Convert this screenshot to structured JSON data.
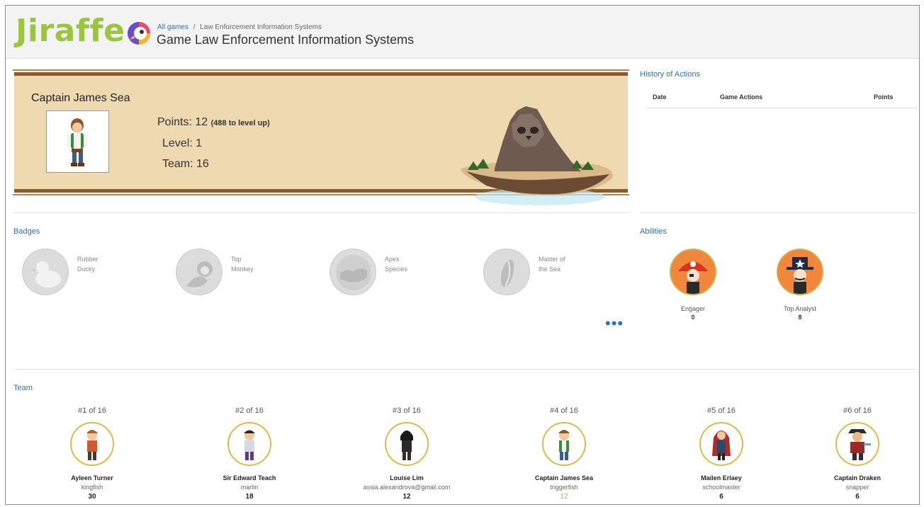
{
  "header": {
    "logo": "Jiraffe",
    "breadcrumb_root": "All games",
    "breadcrumb_sep": "/",
    "breadcrumb_current": "Law Enforcement Information Systems",
    "title": "Game Law Enforcement Information Systems"
  },
  "player": {
    "name": "Captain James Sea",
    "points_label": "Points:",
    "points_value": "12",
    "points_note": "(488 to level up)",
    "level_label": "Level:",
    "level_value": "1",
    "team_label": "Team:",
    "team_value": "16"
  },
  "history": {
    "label": "History of Actions",
    "columns": [
      "Date",
      "Game Actions",
      "Points"
    ]
  },
  "badges": {
    "label": "Badges",
    "items": [
      {
        "name": "Rubber\nDucky",
        "icon": "duck-icon"
      },
      {
        "name": "Top\nMonkey",
        "icon": "monkey-icon"
      },
      {
        "name": "Apex\nSpecies",
        "icon": "globe-icon"
      },
      {
        "name": "Master of\nthe Sea",
        "icon": "wave-icon"
      }
    ],
    "more": "•••"
  },
  "abilities": {
    "label": "Abilities",
    "items": [
      {
        "name": "Engager",
        "value": "0",
        "icon": "pirate-icon"
      },
      {
        "name": "Top Analyst",
        "value": "8",
        "icon": "sheriff-icon"
      }
    ]
  },
  "team": {
    "label": "Team",
    "members": [
      {
        "rank": "#1 of 16",
        "name": "Ayleen Turner",
        "sub": "kingfish",
        "points": "30"
      },
      {
        "rank": "#2 of 16",
        "name": "Sir Edward Teach",
        "sub": "marlin",
        "points": "18"
      },
      {
        "rank": "#3 of 16",
        "name": "Louise Lim",
        "sub": "assia.alexandrova@gmail.com",
        "points": "12"
      },
      {
        "rank": "#4 of 16",
        "name": "Captain James Sea",
        "sub": "triggerfish",
        "points": "12"
      },
      {
        "rank": "#5 of 16",
        "name": "Mailen Erlaey",
        "sub": "schoolmaster",
        "points": "6"
      },
      {
        "rank": "#6 of 16",
        "name": "Captain Draken",
        "sub": "snapper",
        "points": "6"
      }
    ]
  },
  "colors": {
    "accent": "#2f6fb5",
    "logo": "#9bc53d",
    "parchment": "#efd9b0",
    "highlight": "#e0a336"
  }
}
